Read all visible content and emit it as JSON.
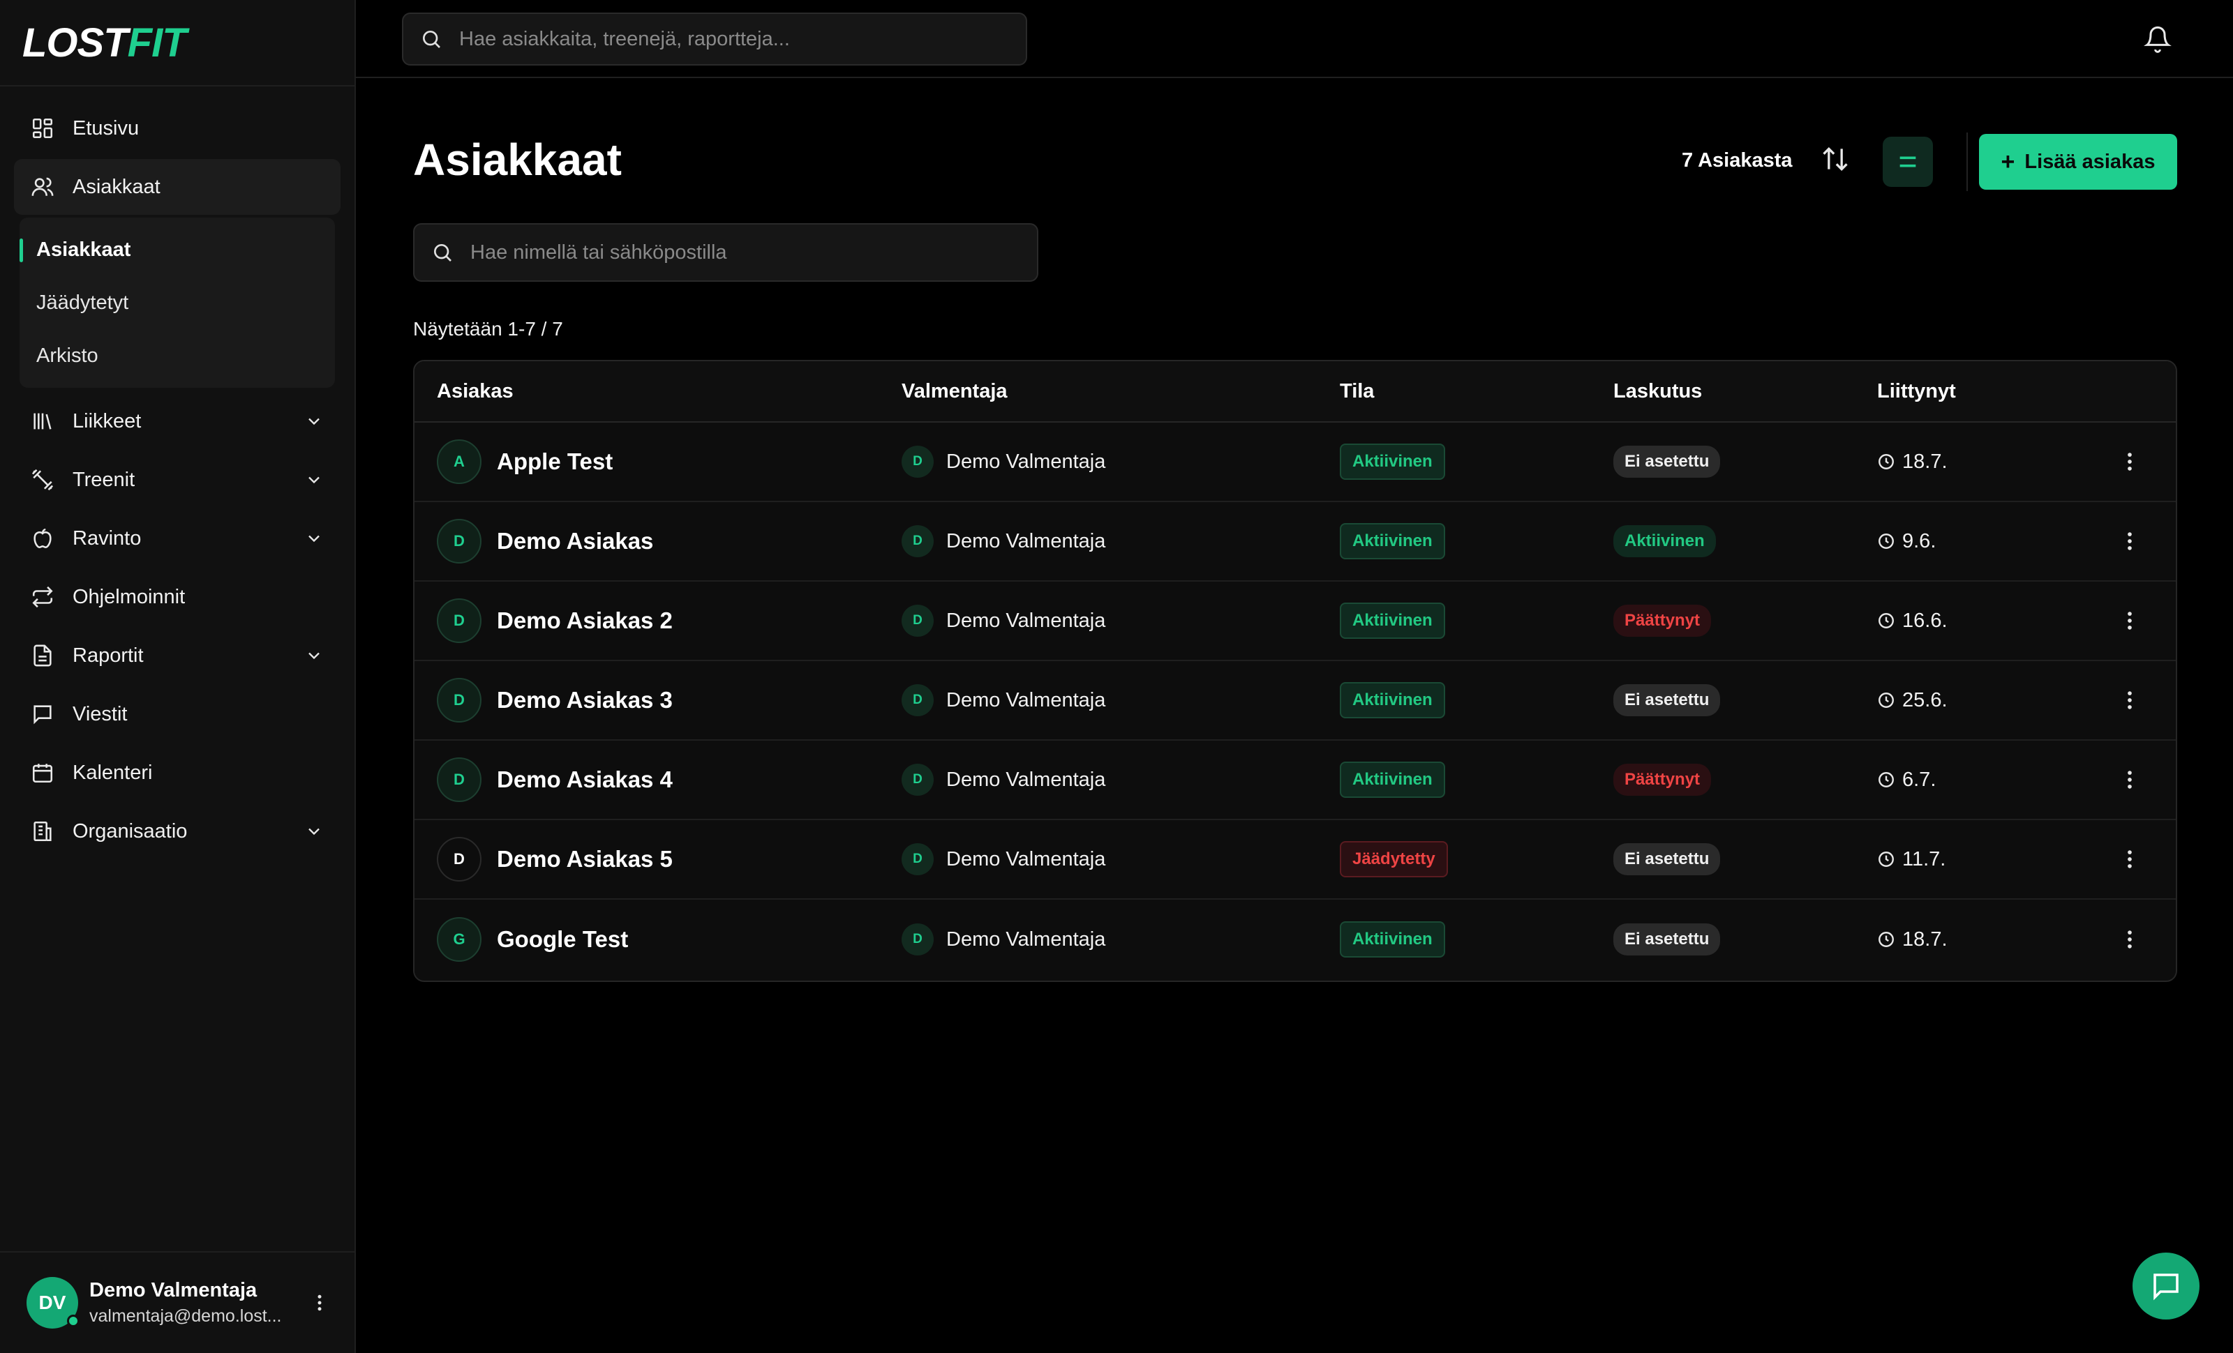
{
  "brand": {
    "logo_part1": "LOST",
    "logo_part2": "FIT"
  },
  "search": {
    "placeholder": "Hae asiakkaita, treenejä, raportteja..."
  },
  "sidebar": {
    "items": [
      {
        "label": "Etusivu",
        "icon": "dashboard-icon"
      },
      {
        "label": "Asiakkaat",
        "icon": "users-icon",
        "active": true
      },
      {
        "label": "Liikkeet",
        "icon": "library-icon",
        "expandable": true
      },
      {
        "label": "Treenit",
        "icon": "dumbbell-icon",
        "expandable": true
      },
      {
        "label": "Ravinto",
        "icon": "apple-icon",
        "expandable": true
      },
      {
        "label": "Ohjelmoinnit",
        "icon": "repeat-icon"
      },
      {
        "label": "Raportit",
        "icon": "file-icon",
        "expandable": true
      },
      {
        "label": "Viestit",
        "icon": "message-icon"
      },
      {
        "label": "Kalenteri",
        "icon": "calendar-icon"
      },
      {
        "label": "Organisaatio",
        "icon": "building-icon",
        "expandable": true
      }
    ],
    "subitems": [
      {
        "label": "Asiakkaat",
        "active": true
      },
      {
        "label": "Jäädytetyt"
      },
      {
        "label": "Arkisto"
      }
    ]
  },
  "user": {
    "initials": "DV",
    "name": "Demo Valmentaja",
    "email": "valmentaja@demo.lost..."
  },
  "page": {
    "title": "Asiakkaat",
    "count_label": "7 Asiakasta",
    "add_button": "Lisää asiakas",
    "add_icon": "+",
    "list_search_placeholder": "Hae nimellä tai sähköpostilla",
    "showing": "Näytetään 1-7 / 7"
  },
  "table": {
    "headers": [
      "Asiakas",
      "Valmentaja",
      "Tila",
      "Laskutus",
      "Liittynyt"
    ],
    "rows": [
      {
        "initial": "A",
        "name": "Apple Test",
        "coach_initial": "D",
        "coach": "Demo Valmentaja",
        "status": "Aktiivinen",
        "billing": "Ei asetettu",
        "joined": "18.7."
      },
      {
        "initial": "D",
        "name": "Demo Asiakas",
        "coach_initial": "D",
        "coach": "Demo Valmentaja",
        "status": "Aktiivinen",
        "billing": "Aktiivinen",
        "joined": "9.6."
      },
      {
        "initial": "D",
        "name": "Demo Asiakas 2",
        "coach_initial": "D",
        "coach": "Demo Valmentaja",
        "status": "Aktiivinen",
        "billing": "Päättynyt",
        "joined": "16.6."
      },
      {
        "initial": "D",
        "name": "Demo Asiakas 3",
        "coach_initial": "D",
        "coach": "Demo Valmentaja",
        "status": "Aktiivinen",
        "billing": "Ei asetettu",
        "joined": "25.6."
      },
      {
        "initial": "D",
        "name": "Demo Asiakas 4",
        "coach_initial": "D",
        "coach": "Demo Valmentaja",
        "status": "Aktiivinen",
        "billing": "Päättynyt",
        "joined": "6.7."
      },
      {
        "initial": "D",
        "name": "Demo Asiakas 5",
        "coach_initial": "D",
        "coach": "Demo Valmentaja",
        "status": "Jäädytetty",
        "billing": "Ei asetettu",
        "joined": "11.7."
      },
      {
        "initial": "G",
        "name": "Google Test",
        "coach_initial": "D",
        "coach": "Demo Valmentaja",
        "status": "Aktiivinen",
        "billing": "Ei asetettu",
        "joined": "18.7."
      }
    ]
  },
  "colors": {
    "accent": "#1fcf8f",
    "danger": "#ef4444",
    "background": "#000000",
    "sidebar": "#111111"
  }
}
